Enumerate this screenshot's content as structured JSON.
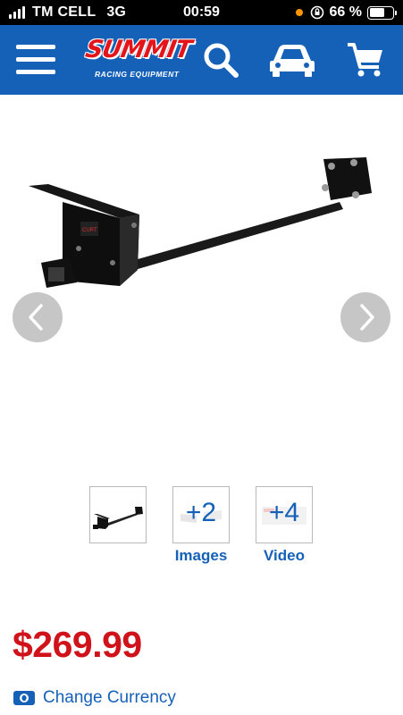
{
  "status_bar": {
    "carrier": "TM CELL",
    "network": "3G",
    "time": "00:59",
    "battery_percent": "66 %",
    "battery_level": 0.66
  },
  "header": {
    "logo_text": "SUMMIT",
    "logo_tagline": "RACING EQUIPMENT",
    "colors": {
      "background": "#1661b8",
      "logo_red": "#e4141b"
    },
    "icons": [
      "menu-icon",
      "search-icon",
      "car-icon",
      "cart-icon"
    ]
  },
  "gallery": {
    "icons": [
      "chevron-left-icon",
      "chevron-right-icon"
    ]
  },
  "thumbnails": [
    {
      "overlay": ""
    },
    {
      "overlay": "+2",
      "label": "Images"
    },
    {
      "overlay": "+4",
      "label": "Video"
    }
  ],
  "price": {
    "value": "$269.99",
    "color": "#d0131b",
    "change_currency_label": "Change Currency",
    "icon": "currency-icon"
  }
}
